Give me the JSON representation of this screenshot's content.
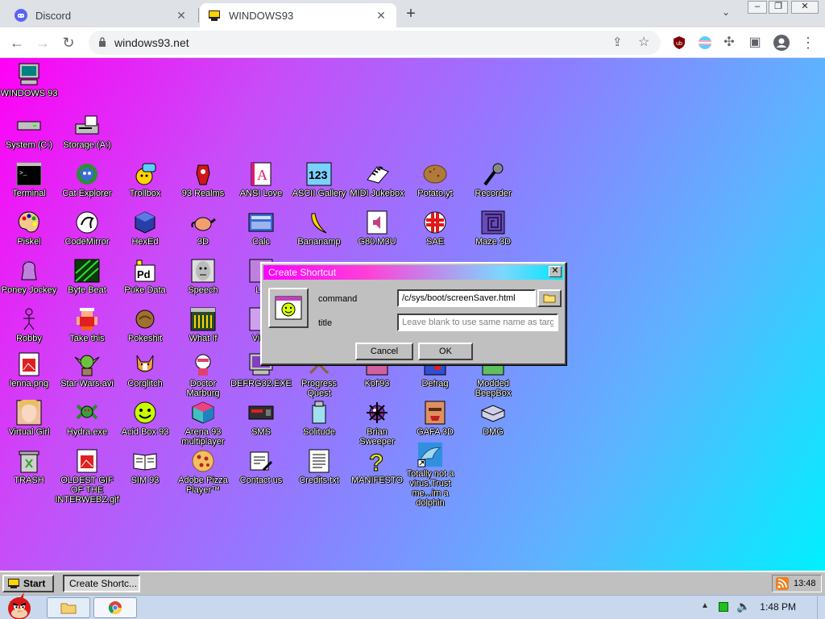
{
  "browser": {
    "tabs": [
      {
        "title": "Discord",
        "active": false
      },
      {
        "title": "WINDOWS93",
        "active": true
      }
    ],
    "url": "windows93.net"
  },
  "desktop": {
    "icons": [
      {
        "label": "WINDOWS 93",
        "icon": "computer-icon"
      },
      {
        "label": "System (C:)",
        "icon": "drive-icon"
      },
      {
        "label": "Storage (A:)",
        "icon": "floppy-drive-icon"
      },
      {
        "label": "Terminal",
        "icon": "terminal-icon"
      },
      {
        "label": "Cat Explorer",
        "icon": "cat-globe-icon"
      },
      {
        "label": "Trollbox",
        "icon": "chat-icon"
      },
      {
        "label": "93 Realms",
        "icon": "realms-icon"
      },
      {
        "label": "ANSI Love",
        "icon": "ansi-icon"
      },
      {
        "label": "ASCII Gallery",
        "icon": "ascii-icon"
      },
      {
        "label": "MIDI Jukebox",
        "icon": "piano-icon"
      },
      {
        "label": "Potato.yt",
        "icon": "potato-icon"
      },
      {
        "label": "Recorder",
        "icon": "microphone-icon"
      },
      {
        "label": "Piskel",
        "icon": "palette-icon"
      },
      {
        "label": "CodeMirror",
        "icon": "codemirror-icon"
      },
      {
        "label": "HexEd",
        "icon": "cube-icon"
      },
      {
        "label": "3D",
        "icon": "teapot-icon"
      },
      {
        "label": "Calc",
        "icon": "calculator-icon"
      },
      {
        "label": "Bananamp",
        "icon": "banana-icon"
      },
      {
        "label": "G80.M3U",
        "icon": "audio-file-icon"
      },
      {
        "label": "SAE",
        "icon": "ball-icon"
      },
      {
        "label": "Maze 3D",
        "icon": "maze-icon"
      },
      {
        "label": "Poney Jockey",
        "icon": "pony-icon"
      },
      {
        "label": "Byte Beat",
        "icon": "bytebeat-icon"
      },
      {
        "label": "Puke Data",
        "icon": "pd-icon"
      },
      {
        "label": "Speech",
        "icon": "face-icon"
      },
      {
        "label": "LS",
        "icon": "ls-icon"
      },
      {
        "label": "Robby",
        "icon": "stickman-icon"
      },
      {
        "label": "Take this",
        "icon": "pixel-man-icon"
      },
      {
        "label": "Pokeshit",
        "icon": "pokeshit-icon"
      },
      {
        "label": "What If",
        "icon": "whatif-icon"
      },
      {
        "label": "Virtu",
        "icon": "virtual-icon"
      },
      {
        "label": "lenna.png",
        "icon": "image-file-icon"
      },
      {
        "label": "Star Wars.avi",
        "icon": "yoda-icon"
      },
      {
        "label": "Corglitch",
        "icon": "corgi-icon"
      },
      {
        "label": "Doctor Marburg",
        "icon": "doctor-icon"
      },
      {
        "label": "DEFRG32.EXE",
        "icon": "defrag-exe-icon"
      },
      {
        "label": "Progress Quest",
        "icon": "progress-quest-icon"
      },
      {
        "label": "Kof'93",
        "icon": "kof-icon"
      },
      {
        "label": "Defrag",
        "icon": "defrag-icon"
      },
      {
        "label": "Modded BeepBox",
        "icon": "beepbox-icon"
      },
      {
        "label": "Virtual Girl",
        "icon": "girl-icon"
      },
      {
        "label": "Hydra.exe",
        "icon": "hydra-icon"
      },
      {
        "label": "Acid Box 93",
        "icon": "smiley-icon"
      },
      {
        "label": "Arena 93 multiplayer",
        "icon": "arena-cube-icon"
      },
      {
        "label": "SMS",
        "icon": "sms-icon"
      },
      {
        "label": "Solitude",
        "icon": "solitude-icon"
      },
      {
        "label": "Brian Sweeper",
        "icon": "mine-icon"
      },
      {
        "label": "GAFA 3D",
        "icon": "gafa-icon"
      },
      {
        "label": "DMG",
        "icon": "dmg-icon"
      },
      {
        "label": "TRASH",
        "icon": "trash-icon"
      },
      {
        "label": "OLDEST GIF OF THE INTERWEBZ.gif",
        "icon": "gif-file-icon"
      },
      {
        "label": "SIM 93",
        "icon": "book-icon"
      },
      {
        "label": "Adobe Pizza Player™",
        "icon": "pizza-icon"
      },
      {
        "label": "Contact us",
        "icon": "contact-icon"
      },
      {
        "label": "Credits.txt",
        "icon": "text-file-icon"
      },
      {
        "label": "MANIFESTO",
        "icon": "question-icon"
      },
      {
        "label": "Totally not a virus.Trust me...im a dolphin",
        "icon": "dolphin-icon"
      }
    ]
  },
  "dialog": {
    "title": "Create Shortcut",
    "command_label": "command",
    "command_value": "/c/sys/boot/screenSaver.html",
    "title_label": "title",
    "title_placeholder": "Leave blank to use same name as target",
    "cancel_label": "Cancel",
    "ok_label": "OK"
  },
  "w93_taskbar": {
    "start_label": "Start",
    "task_label": "Create Shortc...",
    "clock": "13:48"
  },
  "windows_taskbar": {
    "clock": "1:48 PM"
  }
}
